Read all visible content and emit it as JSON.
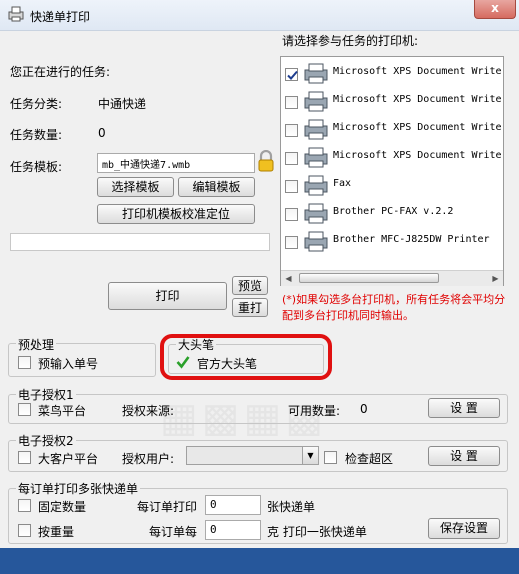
{
  "window": {
    "title": "快递单打印",
    "close_symbol": "x"
  },
  "task": {
    "current_label": "您正在进行的任务:",
    "category_label": "任务分类:",
    "category_value": "中通快递",
    "count_label": "任务数量:",
    "count_value": "0",
    "template_label": "任务模板:",
    "template_value": "mb_中通快递7.wmb",
    "select_template": "选择模板",
    "edit_template": "编辑模板",
    "calibrate": "打印机模板校准定位",
    "print": "打印",
    "preview": "预览",
    "reprint": "重打"
  },
  "printers": {
    "label": "请选择参与任务的打印机:",
    "items": [
      {
        "name": "Microsoft XPS Document Writer",
        "checked": true
      },
      {
        "name": "Microsoft XPS Document Writer",
        "checked": false
      },
      {
        "name": "Microsoft XPS Document Writer",
        "checked": false
      },
      {
        "name": "Microsoft XPS Document Writer",
        "checked": false
      },
      {
        "name": "Fax",
        "checked": false
      },
      {
        "name": "Brother PC-FAX v.2.2",
        "checked": false
      },
      {
        "name": "Brother MFC-J825DW Printer",
        "checked": false
      }
    ],
    "note": "(*)如果勾选多台打印机，所有任务将会平均分配到多台打印机同时输出。"
  },
  "preprocess": {
    "legend": "预处理",
    "pre_input": "预输入单号"
  },
  "bigpen": {
    "legend": "大头笔",
    "official": "官方大头笔",
    "official_checked": true
  },
  "auth1": {
    "legend": "电子授权1",
    "platform": "菜鸟平台",
    "source_label": "授权来源:",
    "available_label": "可用数量:",
    "available_value": "0",
    "settings": "设 置"
  },
  "auth2": {
    "legend": "电子授权2",
    "platform": "大客户平台",
    "user_label": "授权用户:",
    "check_over": "检查超区",
    "settings": "设 置"
  },
  "multi": {
    "legend": "每订单打印多张快递单",
    "fixed_count": "固定数量",
    "per_order_print": "每订单打印",
    "per_order_value": "0",
    "sheets_unit": "张快递单",
    "by_weight": "按重量",
    "per_order_each": "每订单每",
    "weight_value": "0",
    "weight_suffix": "克 打印一张快递单",
    "save_settings": "保存设置"
  },
  "colors": {
    "accent_red": "#e01010",
    "status_bar": "#26579b"
  }
}
